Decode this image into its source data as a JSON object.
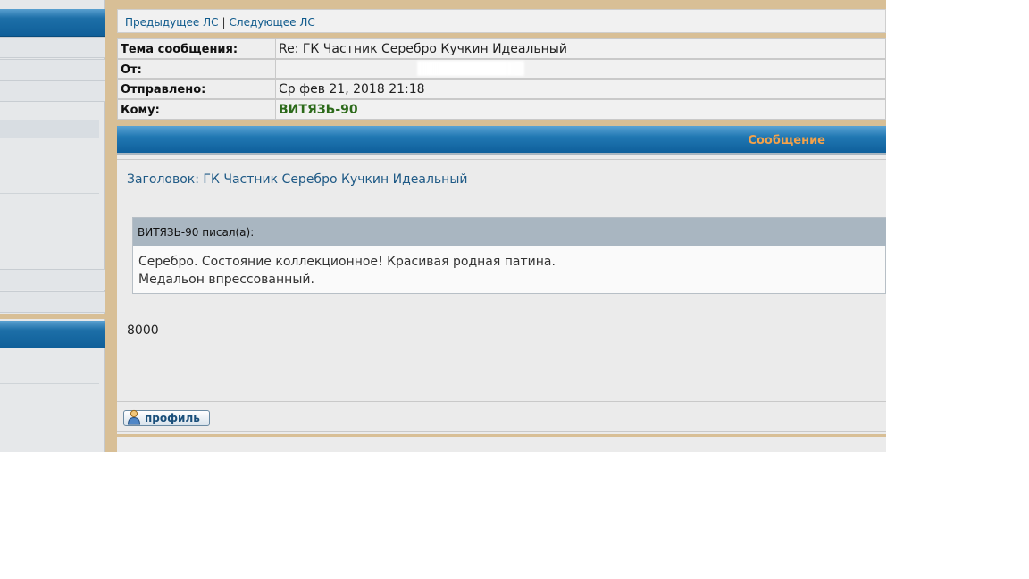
{
  "nav": {
    "prev_label": "Предыдущее ЛС",
    "separator": "|",
    "next_label": "Следующее ЛС"
  },
  "header": {
    "subject_label": "Тема сообщения:",
    "subject_value": "Re: ГК Частник Серебро Кучкин Идеальный",
    "from_label": "От:",
    "sent_label": "Отправлено:",
    "sent_value": "Ср фев 21, 2018 21:18",
    "to_label": "Кому:",
    "to_value": "ВИТЯЗЬ-90"
  },
  "message_bar": {
    "title": "Сообщение"
  },
  "message": {
    "subject_line": "Заголовок: ГК Частник Серебро Кучкин Идеальный",
    "quote_author": "ВИТЯЗЬ-90 писал(а):",
    "quote_line1": "Серебро. Состояние коллекционное! Красивая родная патина.",
    "quote_line2": "Медальон впрессованный.",
    "body_text": "8000"
  },
  "footer": {
    "profile_label": "профиль",
    "profile_icon": "user-icon"
  },
  "colors": {
    "accent_blue": "#1d6fa8",
    "bar_title_orange": "#f4a24a",
    "recipient_green": "#2c6a1a",
    "frame_tan": "#d8bf96"
  }
}
